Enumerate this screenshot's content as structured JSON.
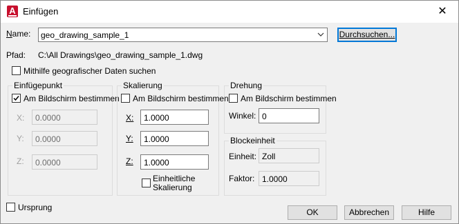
{
  "window": {
    "title": "Einfügen",
    "close_label": "✕",
    "app_icon_letter": "A"
  },
  "name_row": {
    "label": "Name:",
    "value": "geo_drawing_sample_1",
    "browse_label": "Durchsuchen..."
  },
  "path": {
    "label": "Pfad:",
    "value": "C:\\All Drawings\\geo_drawing_sample_1.dwg"
  },
  "geo_search": {
    "label": "Mithilfe geografischer Daten suchen",
    "checked": false
  },
  "insertion_point": {
    "title": "Einfügepunkt",
    "on_screen_label": "Am Bildschirm bestimmen",
    "on_screen_checked": true,
    "x_label": "X:",
    "x_value": "0.0000",
    "y_label": "Y:",
    "y_value": "0.0000",
    "z_label": "Z:",
    "z_value": "0.0000"
  },
  "scale": {
    "title": "Skalierung",
    "on_screen_label": "Am Bildschirm bestimmen",
    "on_screen_checked": false,
    "x_label": "X:",
    "x_value": "1.0000",
    "y_label": "Y:",
    "y_value": "1.0000",
    "z_label": "Z:",
    "z_value": "1.0000",
    "uniform_label_1": "Einheitliche",
    "uniform_label_2": "Skalierung",
    "uniform_checked": false
  },
  "rotation": {
    "title": "Drehung",
    "on_screen_label": "Am Bildschirm bestimmen",
    "on_screen_checked": false,
    "angle_label": "Winkel:",
    "angle_value": "0"
  },
  "block_unit": {
    "title": "Blockeinheit",
    "unit_label": "Einheit:",
    "unit_value": "Zoll",
    "factor_label": "Faktor:",
    "factor_value": "1.0000"
  },
  "explode": {
    "label": "Ursprung",
    "checked": false
  },
  "buttons": {
    "ok": "OK",
    "cancel": "Abbrechen",
    "help": "Hilfe"
  },
  "colors": {
    "dialog_bg": "#f0f0f0",
    "accent": "#0078d7",
    "app_icon": "#c8102e"
  }
}
